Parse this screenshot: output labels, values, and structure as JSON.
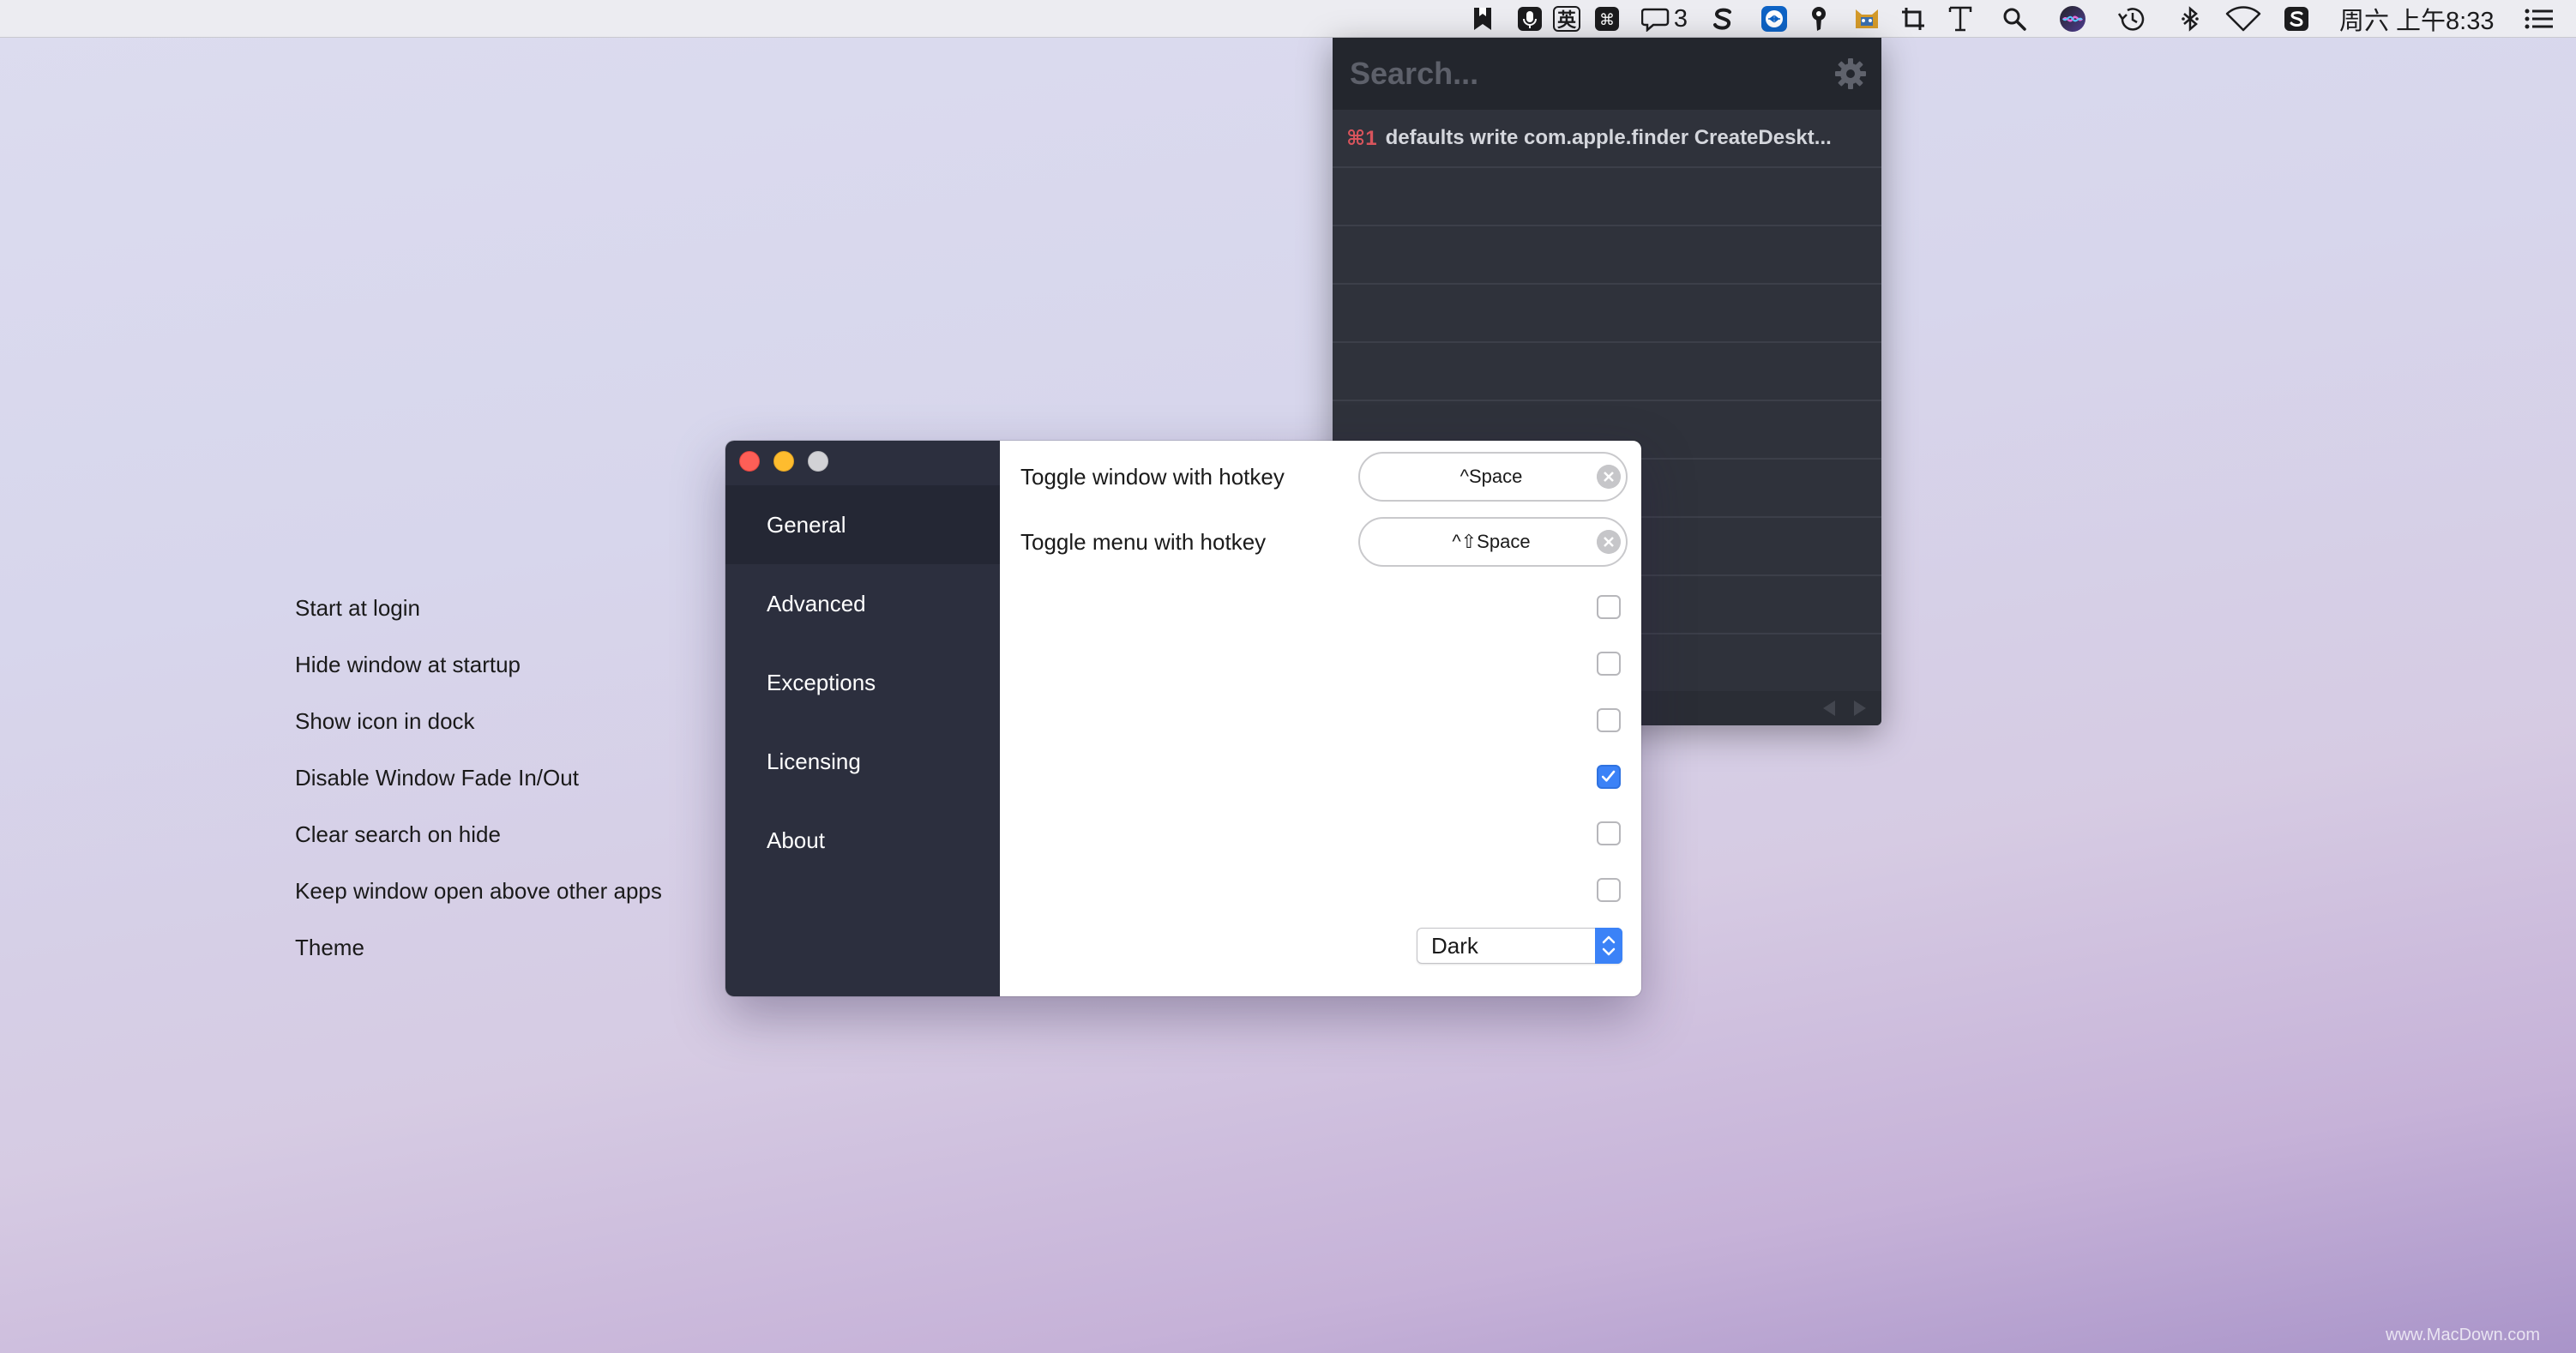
{
  "menubar": {
    "notification_count": "3",
    "ime_label": "英",
    "clock": "周六 上午8:33",
    "icons": [
      "bookmark-icon",
      "microphone-icon",
      "ime-english-icon",
      "command-icon",
      "chat-bubble-icon",
      "scrivener-s-icon",
      "teamviewer-icon",
      "password-key-icon",
      "cat-app-icon",
      "crop-square-icon",
      "text-t-icon",
      "search-icon",
      "siri-icon",
      "time-machine-icon",
      "bluetooth-icon",
      "wifi-icon",
      "s-app-icon",
      "list-menu-icon"
    ]
  },
  "popup": {
    "search_placeholder": "Search...",
    "entries": [
      {
        "shortcut": "⌘1",
        "text": "defaults write com.apple.finder CreateDeskt..."
      }
    ]
  },
  "prefs": {
    "sidebar": [
      {
        "label": "General",
        "active": true
      },
      {
        "label": "Advanced",
        "active": false
      },
      {
        "label": "Exceptions",
        "active": false
      },
      {
        "label": "Licensing",
        "active": false
      },
      {
        "label": "About",
        "active": false
      }
    ],
    "hotkeys": [
      {
        "label": "Toggle window with hotkey",
        "value": "^Space"
      },
      {
        "label": "Toggle menu with hotkey",
        "value": "^⇧Space"
      }
    ],
    "options": [
      {
        "label": "Start at login",
        "checked": false
      },
      {
        "label": "Hide window at startup",
        "checked": false
      },
      {
        "label": "Show icon in dock",
        "checked": false
      },
      {
        "label": "Disable Window Fade In/Out",
        "checked": true
      },
      {
        "label": "Clear search on hide",
        "checked": false
      },
      {
        "label": "Keep window open above other apps",
        "checked": false
      }
    ],
    "theme": {
      "label": "Theme",
      "value": "Dark"
    }
  },
  "watermark": "www.MacDown.com",
  "colors": {
    "accent": "#3b82f7",
    "sidebar": "#2c2f3e",
    "popup_bg": "#2f323b",
    "shortcut_red": "#d8545c"
  }
}
